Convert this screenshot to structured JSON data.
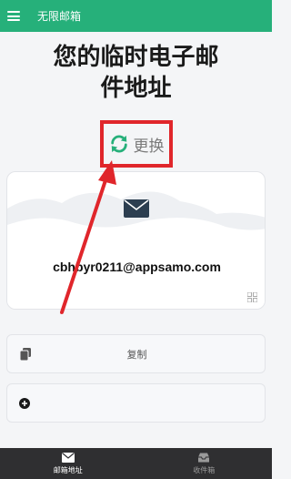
{
  "app": {
    "title": "无限邮箱"
  },
  "hero": {
    "line1": "您的临时电子邮",
    "line2": "件地址"
  },
  "refresh_button": {
    "label": "更换"
  },
  "email_card": {
    "address": "cbhbyr0211@appsamo.com"
  },
  "actions": {
    "copy_label": "复制"
  },
  "bottom_nav": {
    "items": [
      {
        "label": "邮箱地址",
        "icon": "envelope-icon",
        "active": true
      },
      {
        "label": "收件箱",
        "icon": "inbox-icon",
        "active": false
      }
    ]
  },
  "colors": {
    "brand_green": "#26b07a",
    "highlight_red": "#e0262b",
    "nav_background": "#2f2f31"
  }
}
